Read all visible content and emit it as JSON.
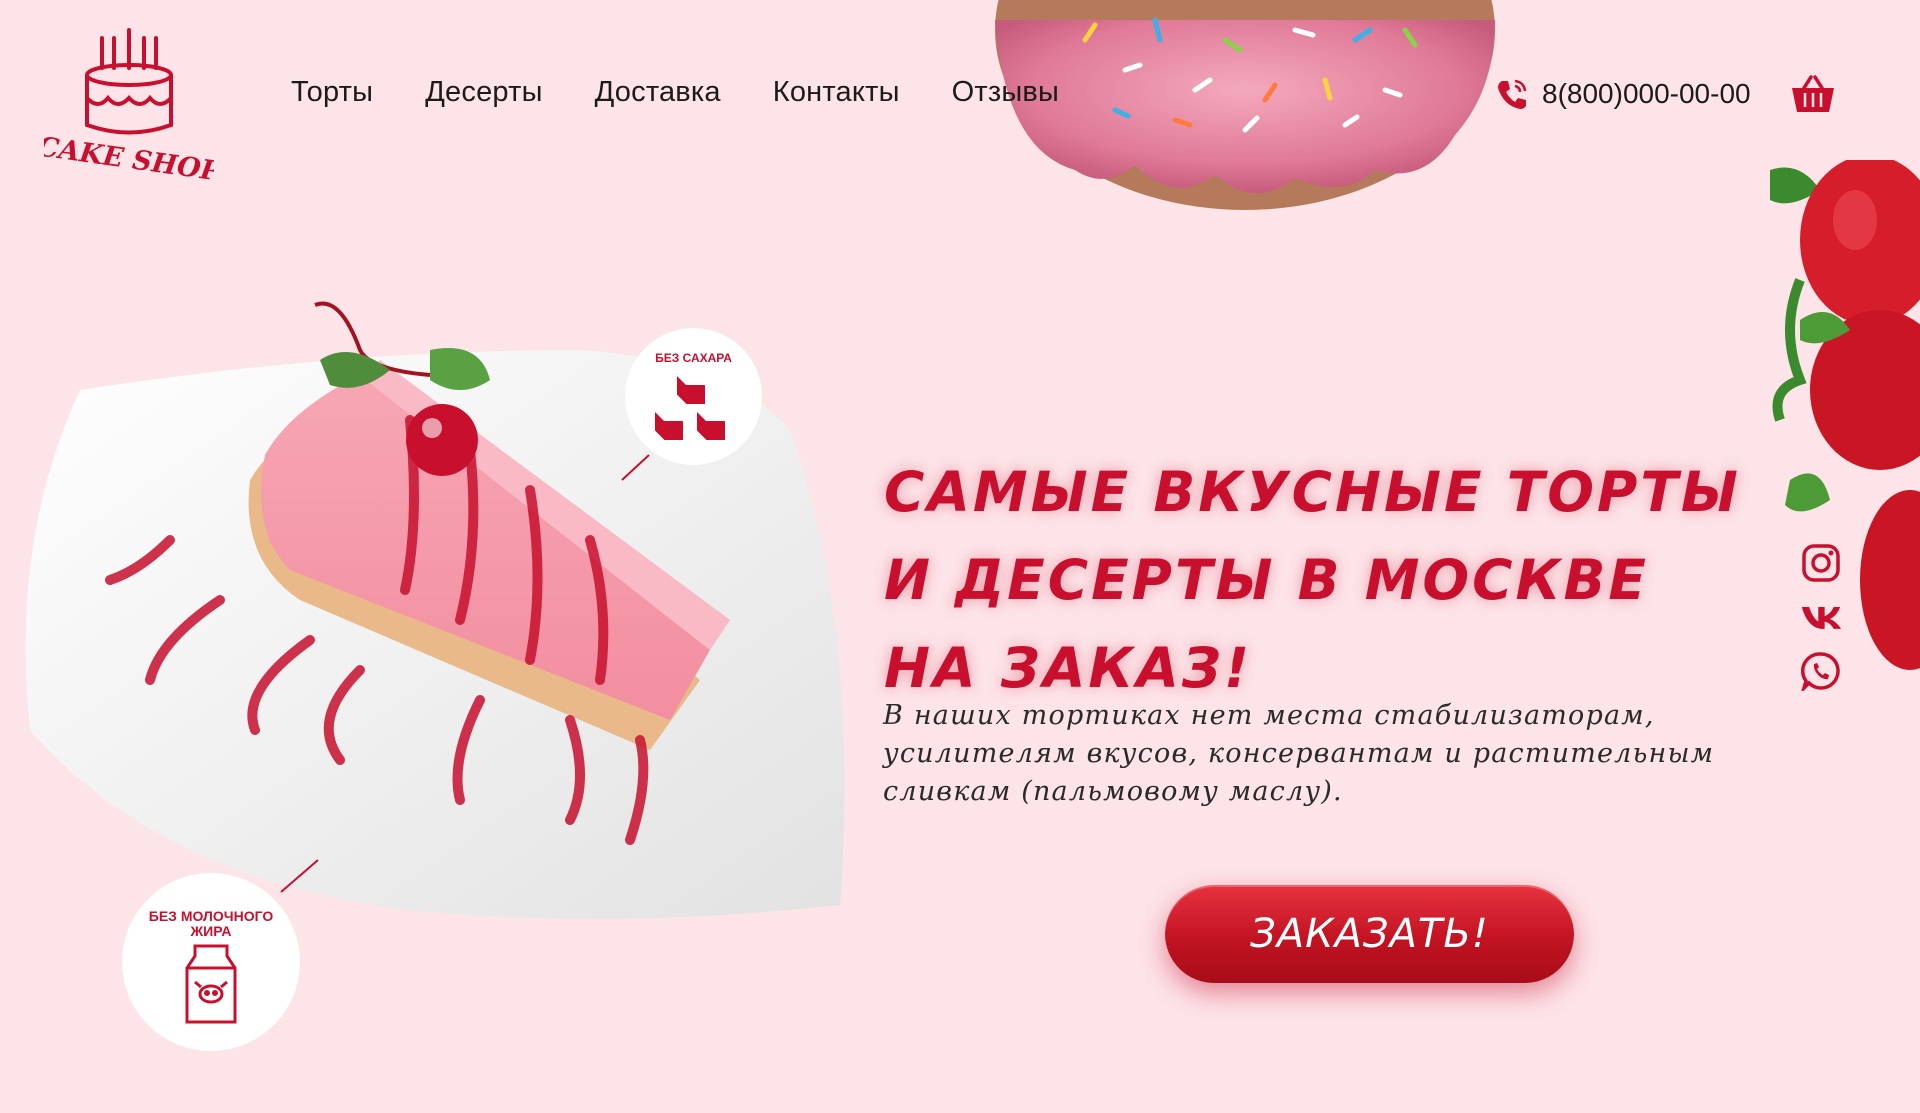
{
  "brand": {
    "logo_text": "CAKE SHOP"
  },
  "nav": {
    "items": [
      {
        "label": "Торты"
      },
      {
        "label": "Десерты"
      },
      {
        "label": "Доставка"
      },
      {
        "label": "Контакты"
      },
      {
        "label": "Отзывы"
      }
    ]
  },
  "header": {
    "phone": "8(800)000-00-00"
  },
  "hero": {
    "headline": "Самые вкусные торты\nи десерты в москве\nна заказ!",
    "subtext": "В наших тортиках нет места стабилизаторам, усилителям вкусов, консервантам и растительным сливкам (пальмовому маслу).",
    "order_button": "ЗАКАЗАТЬ!"
  },
  "badges": {
    "no_sugar": "БЕЗ САХАРА",
    "no_milk_fat": "БЕЗ МОЛОЧНОГО ЖИРА"
  },
  "social": {
    "icons": [
      "instagram-icon",
      "vk-icon",
      "whatsapp-icon"
    ]
  },
  "colors": {
    "background": "#fde4e8",
    "accent": "#c8102e",
    "text": "#1b1b1b"
  }
}
